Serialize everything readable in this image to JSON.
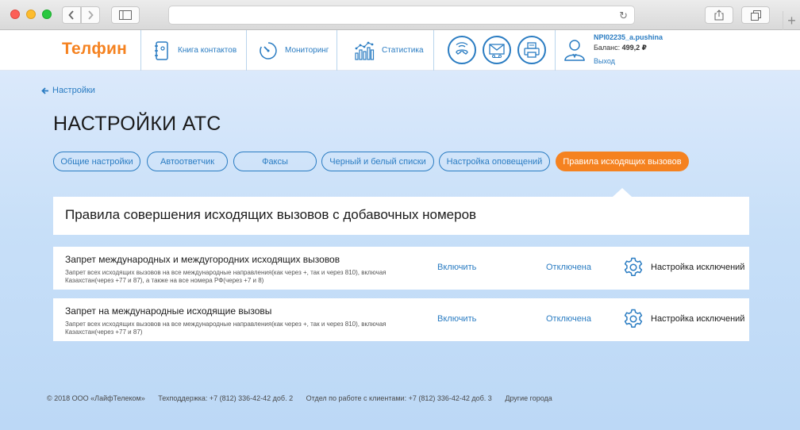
{
  "header": {
    "logo": "Телфин",
    "nav": [
      {
        "label": "Книга контактов",
        "icon": "contacts-book-icon"
      },
      {
        "label": "Мониторинг",
        "icon": "gauge-icon"
      },
      {
        "label": "Статистика",
        "icon": "bar-chart-icon"
      }
    ],
    "quick_icons": [
      "wifi-phone-icon",
      "voicemail-envelope-icon",
      "fax-icon"
    ],
    "user": {
      "name": "NPI02235_a.pushina",
      "balance_label": "Баланс:",
      "balance_value": "499,2 ₽",
      "logout": "Выход"
    }
  },
  "breadcrumb": {
    "back_label": "Настройки"
  },
  "page_title": "НАСТРОЙКИ АТС",
  "tabs": [
    {
      "label": "Общие настройки",
      "active": false
    },
    {
      "label": "Автоответчик",
      "active": false
    },
    {
      "label": "Факсы",
      "active": false
    },
    {
      "label": "Черный и белый списки",
      "active": false
    },
    {
      "label": "Настройка оповещений",
      "active": false
    },
    {
      "label": "Правила исходящих вызовов",
      "active": true
    }
  ],
  "section_title": "Правила совершения исходящих вызовов с добавочных номеров",
  "rules": [
    {
      "title": "Запрет международных и междугородних исходящих вызовов",
      "description": "Запрет всех исходящих вызовов на все международные направления(как через +, так и через 810), включая Казахстан(через +77 и 87), а также на все номера РФ(через +7 и 8)",
      "enable": "Включить",
      "status": "Отключена",
      "exceptions": "Настройка исключений"
    },
    {
      "title": "Запрет на международные исходящие вызовы",
      "description": "Запрет всех исходящих вызовов на все международные направления(как через +, так и через 810), включая Казахстан(через +77 и 87)",
      "enable": "Включить",
      "status": "Отключена",
      "exceptions": "Настройка исключений"
    }
  ],
  "footer": {
    "copyright": "© 2018 ООО «ЛайфТелеком»",
    "support": "Техподдержка: +7 (812) 336-42-42 доб. 2",
    "clients": "Отдел по работе с клиентами: +7 (812) 336-42-42 доб. 3",
    "cities": "Другие города"
  },
  "colors": {
    "accent": "#f58220",
    "link": "#2a7cc2"
  }
}
